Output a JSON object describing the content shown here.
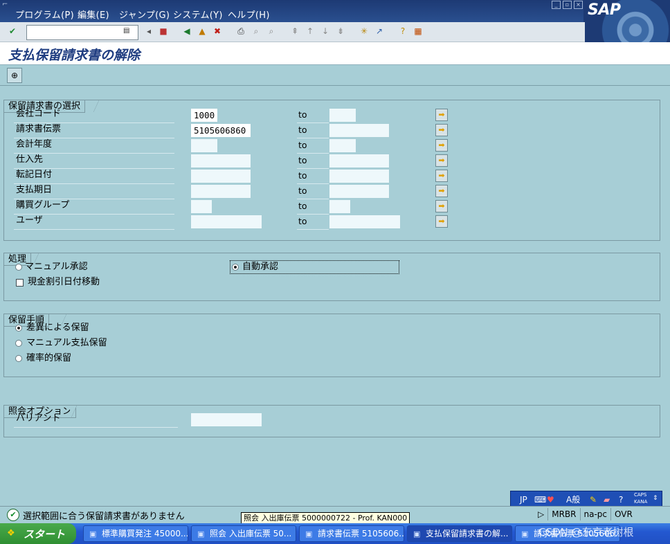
{
  "menu": {
    "items": [
      "プログラム(P)",
      "編集(E)",
      "ジャンプ(G)",
      "システム(Y)",
      "ヘルプ(H)"
    ],
    "logo": "SAP"
  },
  "toolbar": {
    "command_value": "",
    "icons": [
      "enter-icon",
      "save-icon",
      "back-icon",
      "exit-icon",
      "cancel-icon",
      "print-icon",
      "find-icon",
      "find-next-icon",
      "first-page-icon",
      "prev-page-icon",
      "next-page-icon",
      "last-page-icon",
      "new-session-icon",
      "shortcut-icon",
      "help-icon",
      "layout-icon"
    ]
  },
  "page": {
    "title": "支払保留請求書の解除"
  },
  "selection": {
    "title": "保留請求書の選択",
    "rows": [
      {
        "label": "会社コード",
        "from": "1000",
        "to_label": "to",
        "to": ""
      },
      {
        "label": "請求書伝票",
        "from": "5105606860",
        "to_label": "to",
        "to": ""
      },
      {
        "label": "会計年度",
        "from": "",
        "to_label": "to",
        "to": ""
      },
      {
        "label": "仕入先",
        "from": "",
        "to_label": "to",
        "to": ""
      },
      {
        "label": "転記日付",
        "from": "",
        "to_label": "to",
        "to": ""
      },
      {
        "label": "支払期日",
        "from": "",
        "to_label": "to",
        "to": ""
      },
      {
        "label": "購買グループ",
        "from": "",
        "to_label": "to",
        "to": ""
      },
      {
        "label": "ユーザ",
        "from": "",
        "to_label": "to",
        "to": ""
      }
    ]
  },
  "processing": {
    "title": "処理",
    "manual_approval": "マニュアル承認",
    "auto_approval": "自動承認",
    "cash_discount_shift": "現金割引日付移動",
    "selected": "auto_approval"
  },
  "block_proc": {
    "title": "保留手順",
    "options": [
      "差異による保留",
      "マニュアル支払保留",
      "確率的保留"
    ],
    "selected_index": 0
  },
  "display": {
    "title": "照会オプション",
    "variant_label": "バリアント",
    "variant_value": ""
  },
  "status": {
    "message": "選択範囲に合う保留請求書がありません",
    "system": "MRBR",
    "host": "na-pc",
    "mode": "OVR"
  },
  "tooltip": "照会 入出庫伝票 5000000722 - Prof. KAN000",
  "ime": {
    "lang": "JP",
    "mode": "A般",
    "caps": "CAPS",
    "kana": "KANA"
  },
  "taskbar": {
    "start": "スタート",
    "tasks": [
      "標準購買発注 45000...",
      "照会 入出庫伝票 50...",
      "請求書伝票 5105606...",
      "支払保留請求書の解...",
      "請求書伝票 5105606..."
    ],
    "active_index": 3,
    "watermark": "CSDN @东京老树根"
  },
  "colors": {
    "background": "#a7ced6",
    "title_text": "#1e3c80",
    "menu_bar": "#1d3a74",
    "taskbar": "#2458d0"
  }
}
